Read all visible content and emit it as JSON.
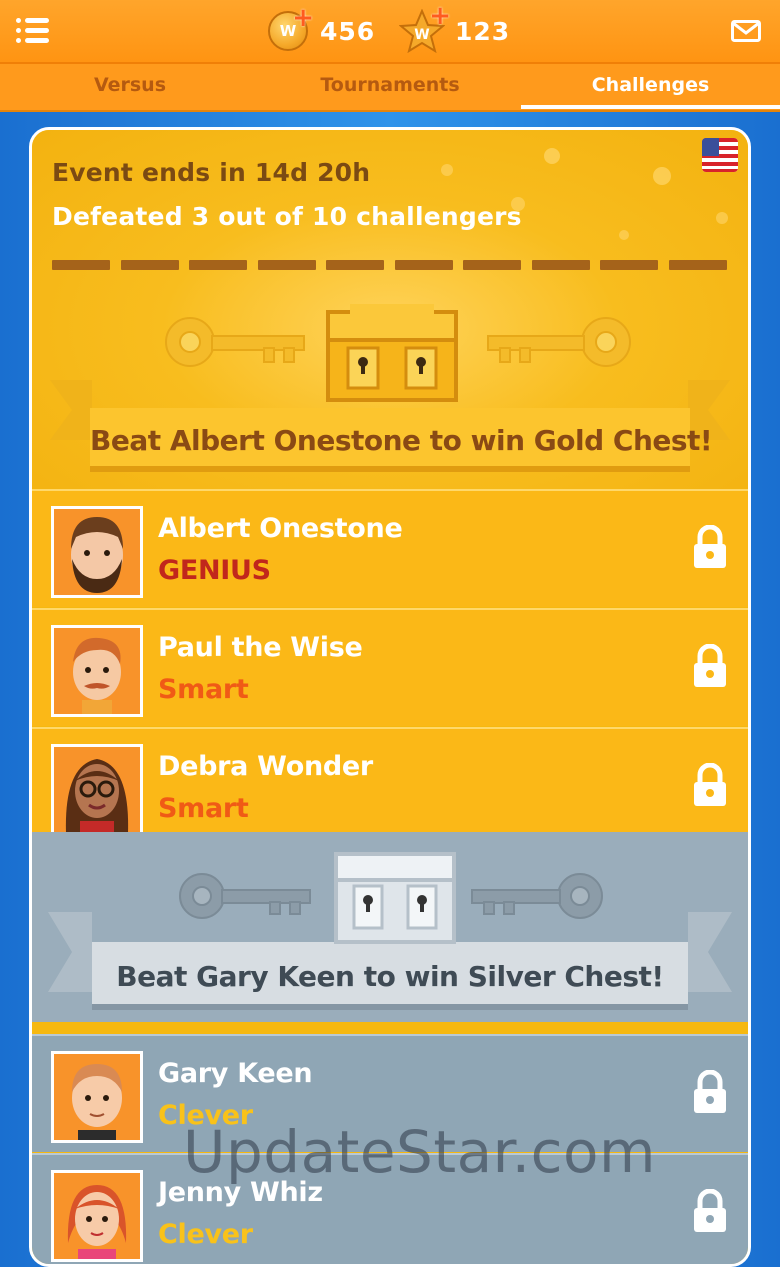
{
  "header": {
    "coins": "456",
    "stars": "123",
    "coin_letter": "W",
    "star_letter": "W"
  },
  "tabs": [
    {
      "label": "Versus"
    },
    {
      "label": "Tournaments"
    },
    {
      "label": "Challenges",
      "active": true
    }
  ],
  "event": {
    "ends_text": "Event ends in 14d 20h",
    "progress_text": "Defeated 3 out of 10 challengers",
    "defeated": 3,
    "total": 10
  },
  "gold_section": {
    "banner": "Beat Albert Onestone to win Gold Chest!",
    "challengers": [
      {
        "name": "Albert Onestone",
        "level": "GENIUS",
        "level_color": "#c1271c"
      },
      {
        "name": "Paul the Wise",
        "level": "Smart",
        "level_color": "#f05a16"
      },
      {
        "name": "Debra Wonder",
        "level": "Smart",
        "level_color": "#f05a16"
      }
    ]
  },
  "silver_section": {
    "banner": "Beat Gary Keen to win Silver Chest!",
    "challengers": [
      {
        "name": "Gary Keen",
        "level": "Clever",
        "level_color": "#f9c21a"
      },
      {
        "name": "Jenny Whiz",
        "level": "Clever",
        "level_color": "#f9c21a"
      }
    ]
  },
  "watermark": "UpdateStar.com",
  "icons": [
    "menu-icon",
    "coin-icon",
    "star-icon",
    "mail-icon",
    "flag-icon",
    "chest-icon",
    "key-icon",
    "lock-icon"
  ]
}
